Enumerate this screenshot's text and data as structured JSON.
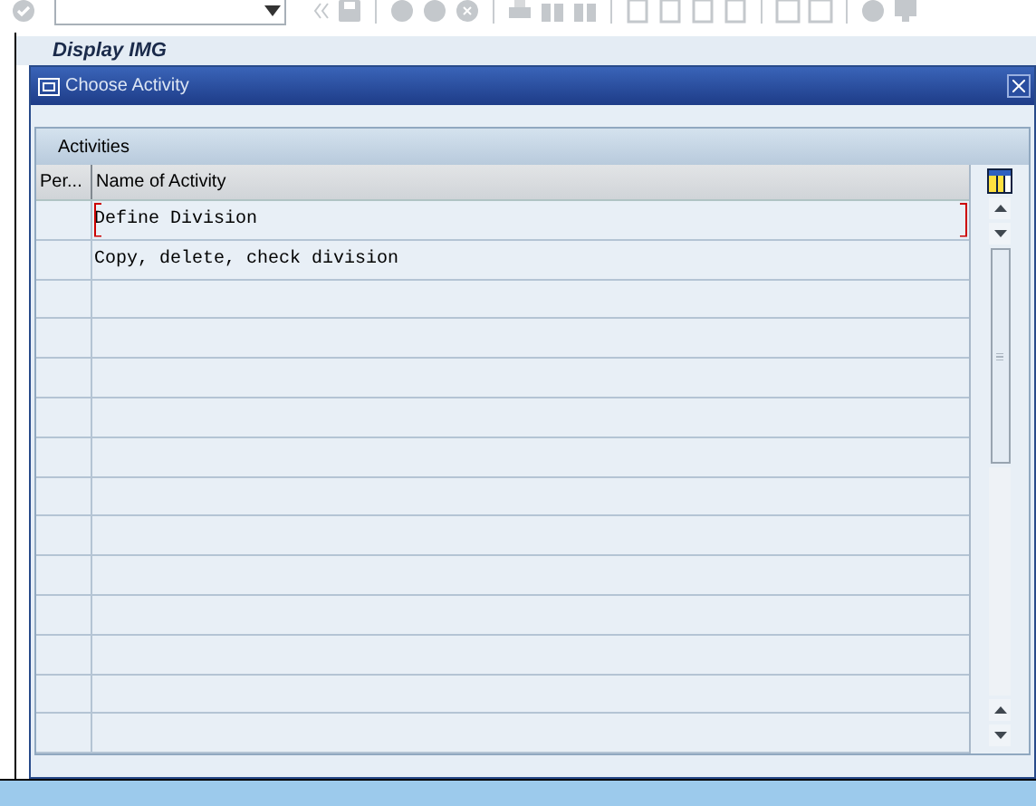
{
  "background_title": "Display IMG",
  "dialog": {
    "title": "Choose Activity",
    "group_title": "Activities",
    "columns": [
      "Per...",
      "Name of Activity"
    ],
    "rows": [
      {
        "name": "Define Division",
        "selected": true
      },
      {
        "name": "Copy, delete, check division",
        "selected": false
      }
    ]
  }
}
